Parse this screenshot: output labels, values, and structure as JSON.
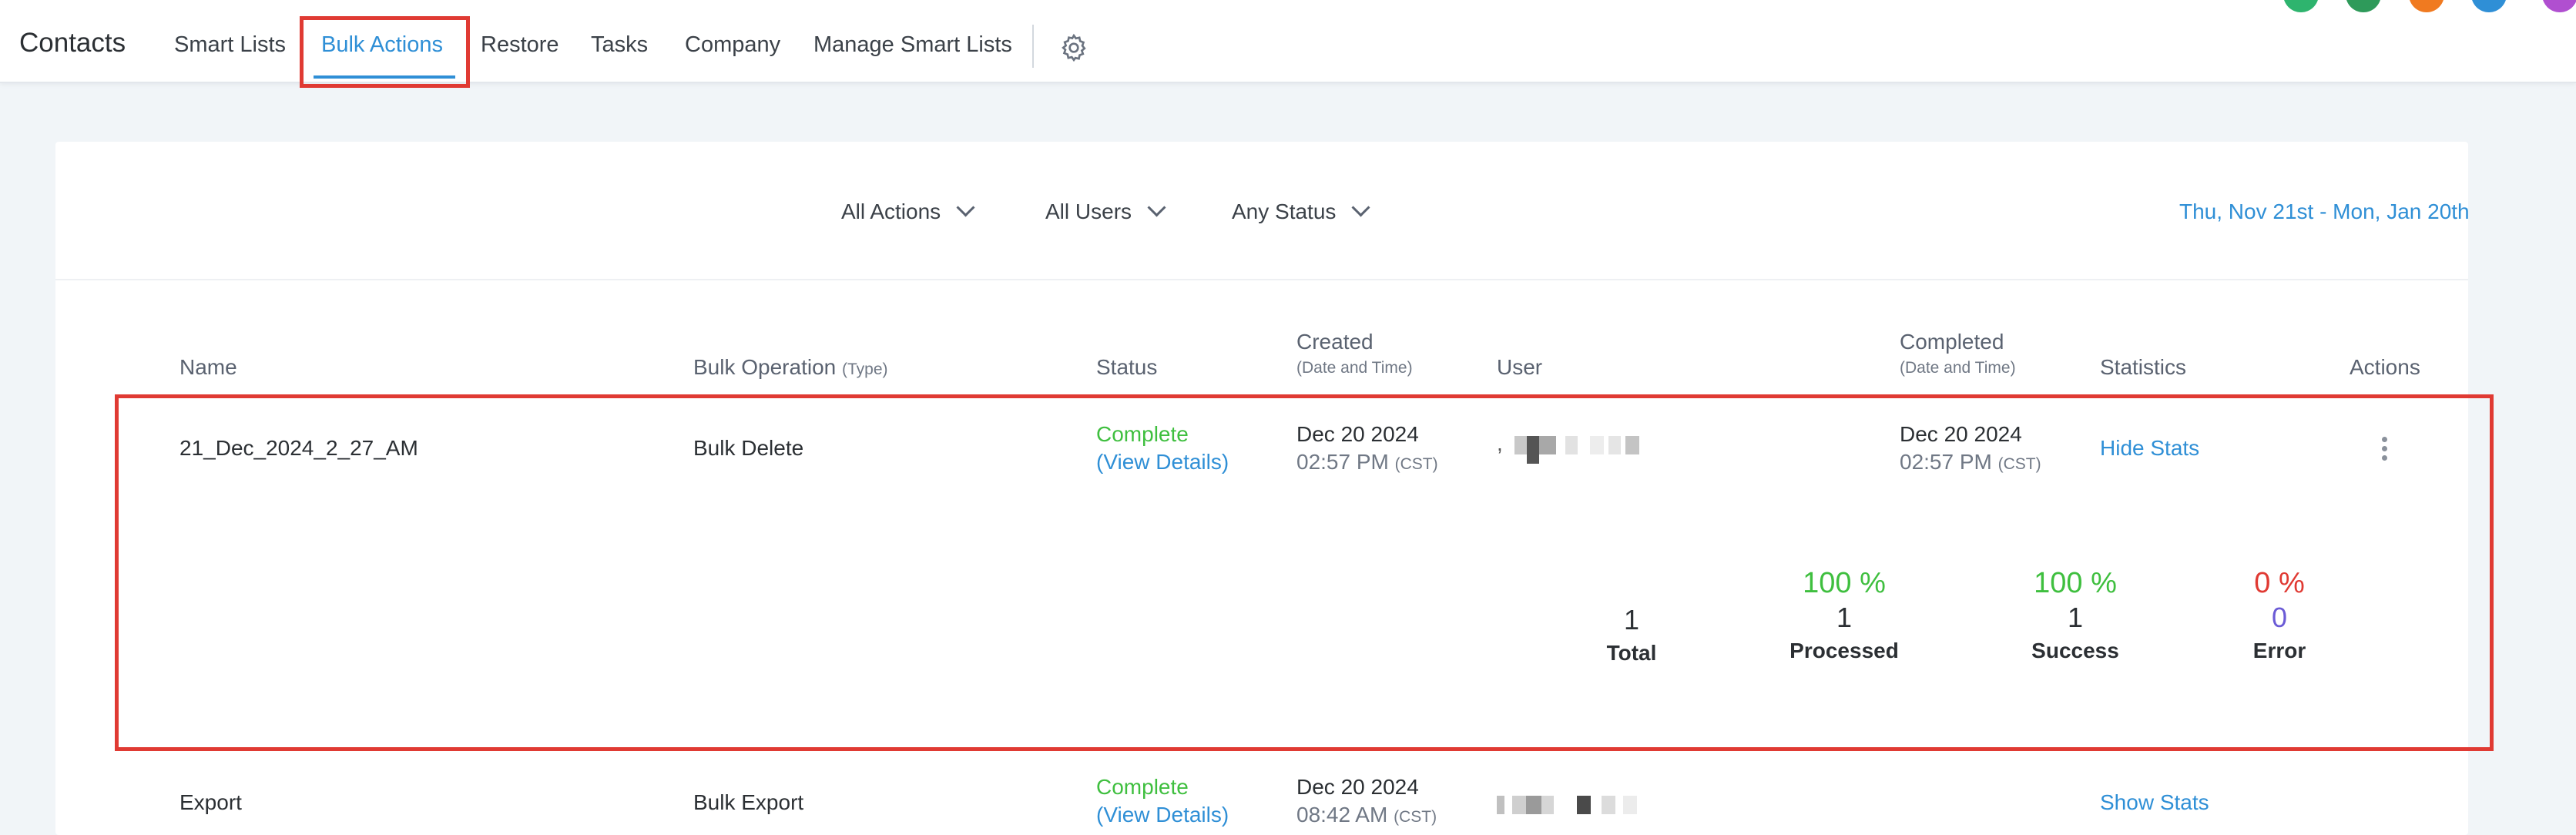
{
  "header": {
    "app_title": "Contacts",
    "tabs": [
      {
        "label": "Smart Lists"
      },
      {
        "label": "Bulk Actions"
      },
      {
        "label": "Restore"
      },
      {
        "label": "Tasks"
      },
      {
        "label": "Company"
      },
      {
        "label": "Manage Smart Lists"
      }
    ],
    "active_tab": "Bulk Actions",
    "settings_icon": "gear-icon",
    "avatar_colors": [
      "#2eb46e",
      "#2e9a5a",
      "#f07a20",
      "#2f8fd6",
      "#b04fd0"
    ]
  },
  "filters": {
    "actions": "All Actions",
    "users": "All Users",
    "status": "Any Status",
    "date_range": "Thu, Nov 21st - Mon, Jan 20th"
  },
  "table": {
    "columns": {
      "name": "Name",
      "operation": "Bulk Operation",
      "operation_hint": "(Type)",
      "status": "Status",
      "created": "Created",
      "created_hint": "(Date and Time)",
      "user": "User",
      "completed": "Completed",
      "completed_hint": "(Date and Time)",
      "statistics": "Statistics",
      "actions": "Actions"
    },
    "rows": [
      {
        "name": "21_Dec_2024_2_27_AM",
        "operation": "Bulk Delete",
        "status": "Complete",
        "details_link": "(View Details)",
        "created_date": "Dec 20 2024",
        "created_time": "02:57 PM",
        "created_tz": "(CST)",
        "user_prefix": ",",
        "completed_date": "Dec 20 2024",
        "completed_time": "02:57 PM",
        "completed_tz": "(CST)",
        "stats_toggle": "Hide Stats",
        "stats": {
          "total": {
            "value": "1",
            "label": "Total"
          },
          "processed": {
            "percent": "100 %",
            "value": "1",
            "label": "Processed"
          },
          "success": {
            "percent": "100 %",
            "value": "1",
            "label": "Success"
          },
          "error": {
            "percent": "0 %",
            "value": "0",
            "label": "Error"
          }
        }
      },
      {
        "name": "Export",
        "operation": "Bulk Export",
        "status": "Complete",
        "details_link": "(View Details)",
        "created_date": "Dec 20 2024",
        "created_time": "08:42 AM",
        "created_tz": "(CST)",
        "stats_toggle": "Show Stats"
      }
    ]
  },
  "colors": {
    "accent": "#2f8fd6",
    "success": "#3fbf3f",
    "error": "#e03a33",
    "error_count": "#6b5bd6",
    "highlight": "#e03a33"
  }
}
